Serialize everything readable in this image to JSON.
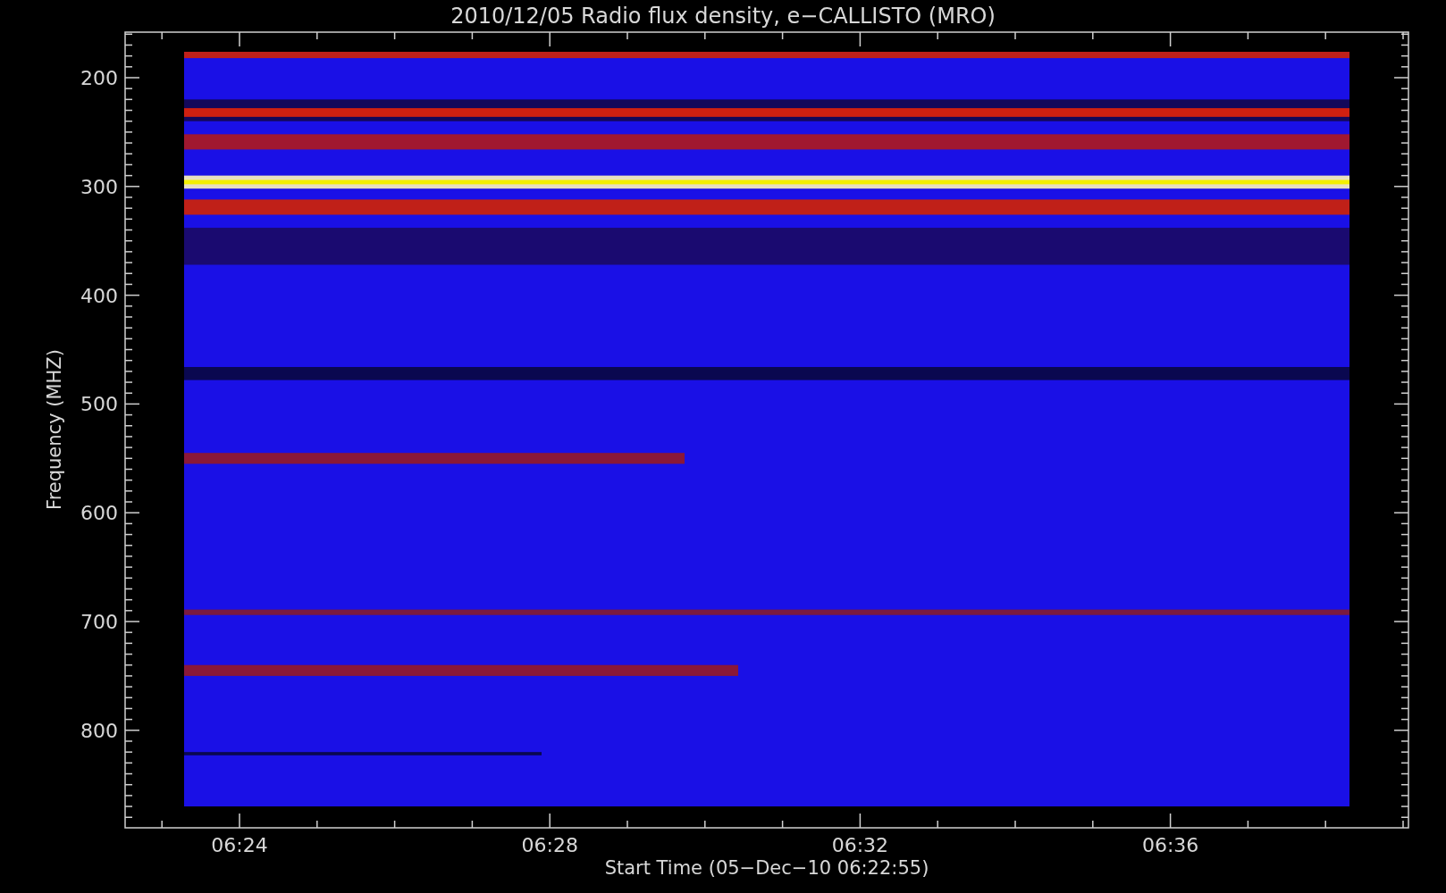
{
  "plot": {
    "title": "2010/12/05  Radio flux density, e−CALLISTO (MRO)",
    "ylabel": "Frequency (MHZ)",
    "xlabel": "Start Time (05−Dec−10 06:22:55)",
    "yticks": [
      "200",
      "300",
      "400",
      "500",
      "600",
      "700",
      "800"
    ],
    "xticks": [
      "06:24",
      "06:28",
      "06:32",
      "06:36"
    ]
  }
}
